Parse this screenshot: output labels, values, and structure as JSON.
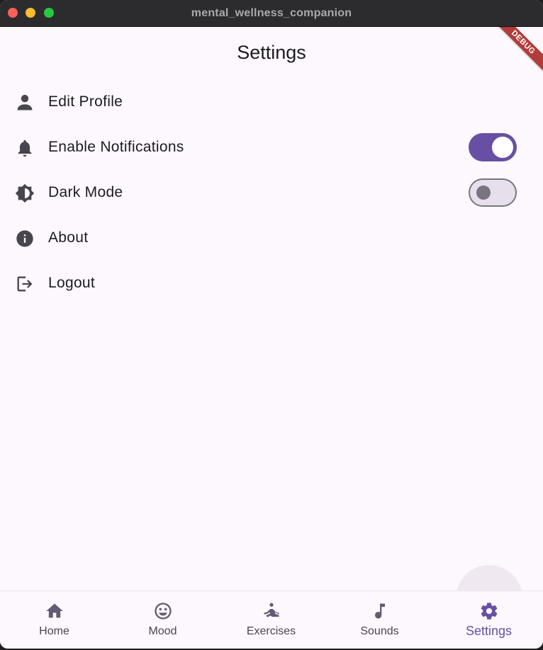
{
  "window": {
    "title": "mental_wellness_companion"
  },
  "appbar": {
    "title": "Settings",
    "debug_label": "DEBUG"
  },
  "settings": [
    {
      "label": "Edit Profile",
      "icon": "person-icon"
    },
    {
      "label": "Enable Notifications",
      "icon": "bell-icon",
      "toggle": true,
      "value": true
    },
    {
      "label": "Dark Mode",
      "icon": "brightness-icon",
      "toggle": true,
      "value": false
    },
    {
      "label": "About",
      "icon": "info-icon"
    },
    {
      "label": "Logout",
      "icon": "logout-icon"
    }
  ],
  "nav": {
    "items": [
      {
        "label": "Home",
        "icon": "home-icon"
      },
      {
        "label": "Mood",
        "icon": "smiley-icon"
      },
      {
        "label": "Exercises",
        "icon": "meditation-icon"
      },
      {
        "label": "Sounds",
        "icon": "music-note-icon"
      },
      {
        "label": "Settings",
        "icon": "gear-icon",
        "active": true
      }
    ]
  },
  "colors": {
    "primary": "#6750a4",
    "background": "#fdf7fe",
    "debug": "#b13c3a"
  }
}
